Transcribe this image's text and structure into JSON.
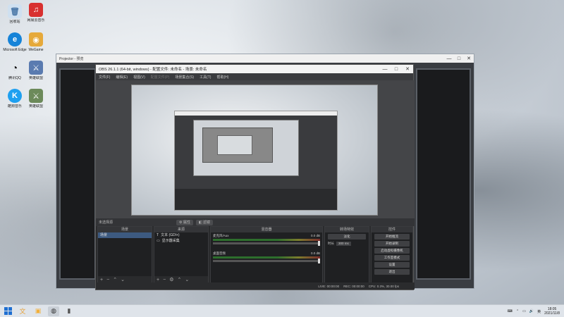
{
  "desktop": {
    "icons": [
      {
        "label": "回收站",
        "glyph": "🗑",
        "color": "#7aa7d6"
      },
      {
        "label": "网易云音乐",
        "glyph": "♫",
        "color": "#d8302f"
      },
      {
        "label": "Microsoft Edge",
        "glyph": "e",
        "color": "#1583d8"
      },
      {
        "label": "WeGame",
        "glyph": "◉",
        "color": "#e6a93a"
      },
      {
        "label": "腾讯QQ",
        "glyph": "◔",
        "color": "#222"
      },
      {
        "label": "英雄联盟",
        "glyph": "⚔",
        "color": "#5a7bb0"
      },
      {
        "label": "酷狗音乐",
        "glyph": "K",
        "color": "#1ea0f0"
      },
      {
        "label": "英雄联盟",
        "glyph": "⚔",
        "color": "#6c8a5a"
      }
    ]
  },
  "outer_window": {
    "title": "Projector - 预览",
    "min": "—",
    "max": "□",
    "close": "✕"
  },
  "obs": {
    "title": "OBS 26.1.1 (64-bit, windows) - 配置文件: 未命名 - 场景: 未命名",
    "min": "—",
    "max": "□",
    "close": "✕",
    "menu": [
      "文件(F)",
      "编辑(E)",
      "视图(V)",
      "配置文件(P)",
      "场景集合(S)",
      "工具(T)",
      "帮助(H)"
    ],
    "scene_bar_label": "未选择源",
    "scene_bar_buttons": [
      "⚙ 属性",
      "◧ 滤镜"
    ],
    "docks": {
      "scenes": {
        "title": "场景",
        "items": [
          "场景"
        ]
      },
      "sources": {
        "title": "来源",
        "items": [
          {
            "icon": "T",
            "label": "文本 (GDI+)"
          },
          {
            "icon": "▭",
            "label": "显示器采集"
          }
        ]
      },
      "mixer": {
        "title": "混音器",
        "rows": [
          {
            "name": "麦克风/Aux",
            "db": "0.0 dB"
          },
          {
            "name": "桌面音频",
            "db": "0.0 dB"
          }
        ]
      },
      "transitions": {
        "title": "转场特效",
        "type": "淡化",
        "duration_label": "时长",
        "duration": "300 ms"
      },
      "controls": {
        "title": "控件",
        "buttons": [
          "开始推流",
          "开始录制",
          "启动虚拟摄像机",
          "工作室模式",
          "设置",
          "退出"
        ]
      }
    },
    "status": {
      "live": "LIVE: 00:00:00",
      "rec": "REC: 00:00:00",
      "cpu": "CPU: 0.3%, 30.00 fps"
    }
  },
  "taskbar": {
    "clock_time": "18:05",
    "clock_date": "2021/11/8",
    "lang": "英",
    "apps": [
      {
        "glyph": "文",
        "color": "#e7a23a"
      },
      {
        "glyph": "▣",
        "color": "#f2b03a"
      },
      {
        "glyph": "◍",
        "color": "#333"
      },
      {
        "glyph": "▮",
        "color": "#555"
      }
    ]
  }
}
